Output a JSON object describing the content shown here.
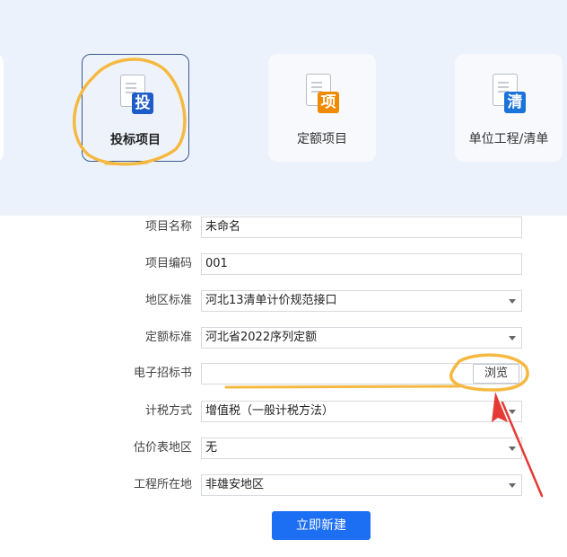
{
  "project_types": [
    {
      "label": "投标项目",
      "badge": "投",
      "badge_color": "#1f5cc8",
      "selected": true
    },
    {
      "label": "定额项目",
      "badge": "项",
      "badge_color": "#f08a00",
      "selected": false
    },
    {
      "label": "单位工程/清单",
      "badge": "清",
      "badge_color": "#1a73d9",
      "selected": false
    }
  ],
  "form": {
    "project_name": {
      "label": "项目名称",
      "value": "未命名"
    },
    "project_code": {
      "label": "项目编码",
      "value": "001"
    },
    "region_standard": {
      "label": "地区标准",
      "value": "河北13清单计价规范接口"
    },
    "quota_standard": {
      "label": "定额标准",
      "value": "河北省2022序列定额"
    },
    "e_tender": {
      "label": "电子招标书",
      "value": "",
      "browse_label": "浏览"
    },
    "tax_method": {
      "label": "计税方式",
      "value": "增值税（一般计税方法）"
    },
    "price_region": {
      "label": "估价表地区",
      "value": "无"
    },
    "project_location": {
      "label": "工程所在地",
      "value": "非雄安地区"
    }
  },
  "actions": {
    "create_label": "立即新建"
  },
  "colors": {
    "accent": "#1c6ef2",
    "annotation": "#f5b942",
    "arrow": "#e53935"
  }
}
